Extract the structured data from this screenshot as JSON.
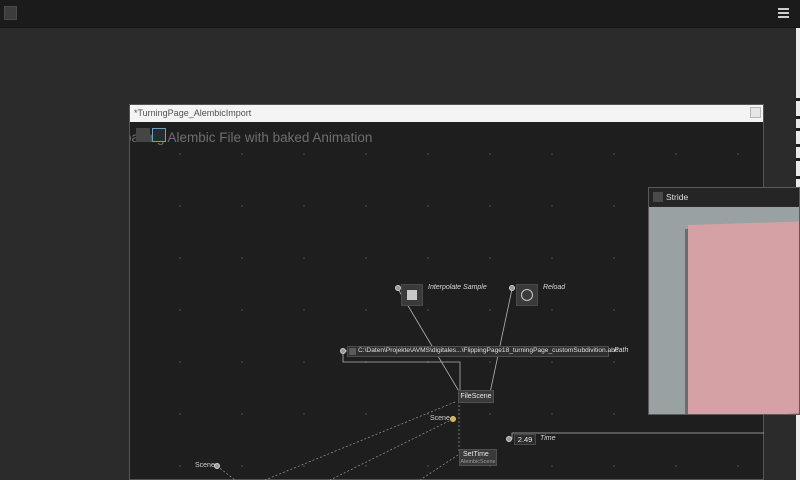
{
  "window": {
    "title": "*TurningPage_AlembicImport",
    "canvas_title": "oading Alembic File with baked Animation"
  },
  "nodes": {
    "interpolate_label": "Interpolate Sample",
    "reload_label": "Reload",
    "path_value": "C:\\Daten\\Projekte\\AVMS\\digitales...\\FlippingPage18_turningPage_customSubdivition.abc",
    "path_label": "Path",
    "filescene_title": "FileScene",
    "scene_label_1": "Scene",
    "scene_label_2": "Scene",
    "settime_title": "SetTime",
    "settime_subtitle": "AlembicScene",
    "time_value": "2.49",
    "time_label": "Time"
  },
  "stride": {
    "title": "Stride"
  },
  "colors": {
    "page": "#d6a1a4",
    "viewport_bg": "#9aa1a3",
    "selection_accent": "#6aa0d0"
  },
  "icons": {
    "menu": "hamburger-menu-icon",
    "interpolate_toggle": "square-toggle-icon",
    "reload_bang": "circle-bang-icon"
  }
}
